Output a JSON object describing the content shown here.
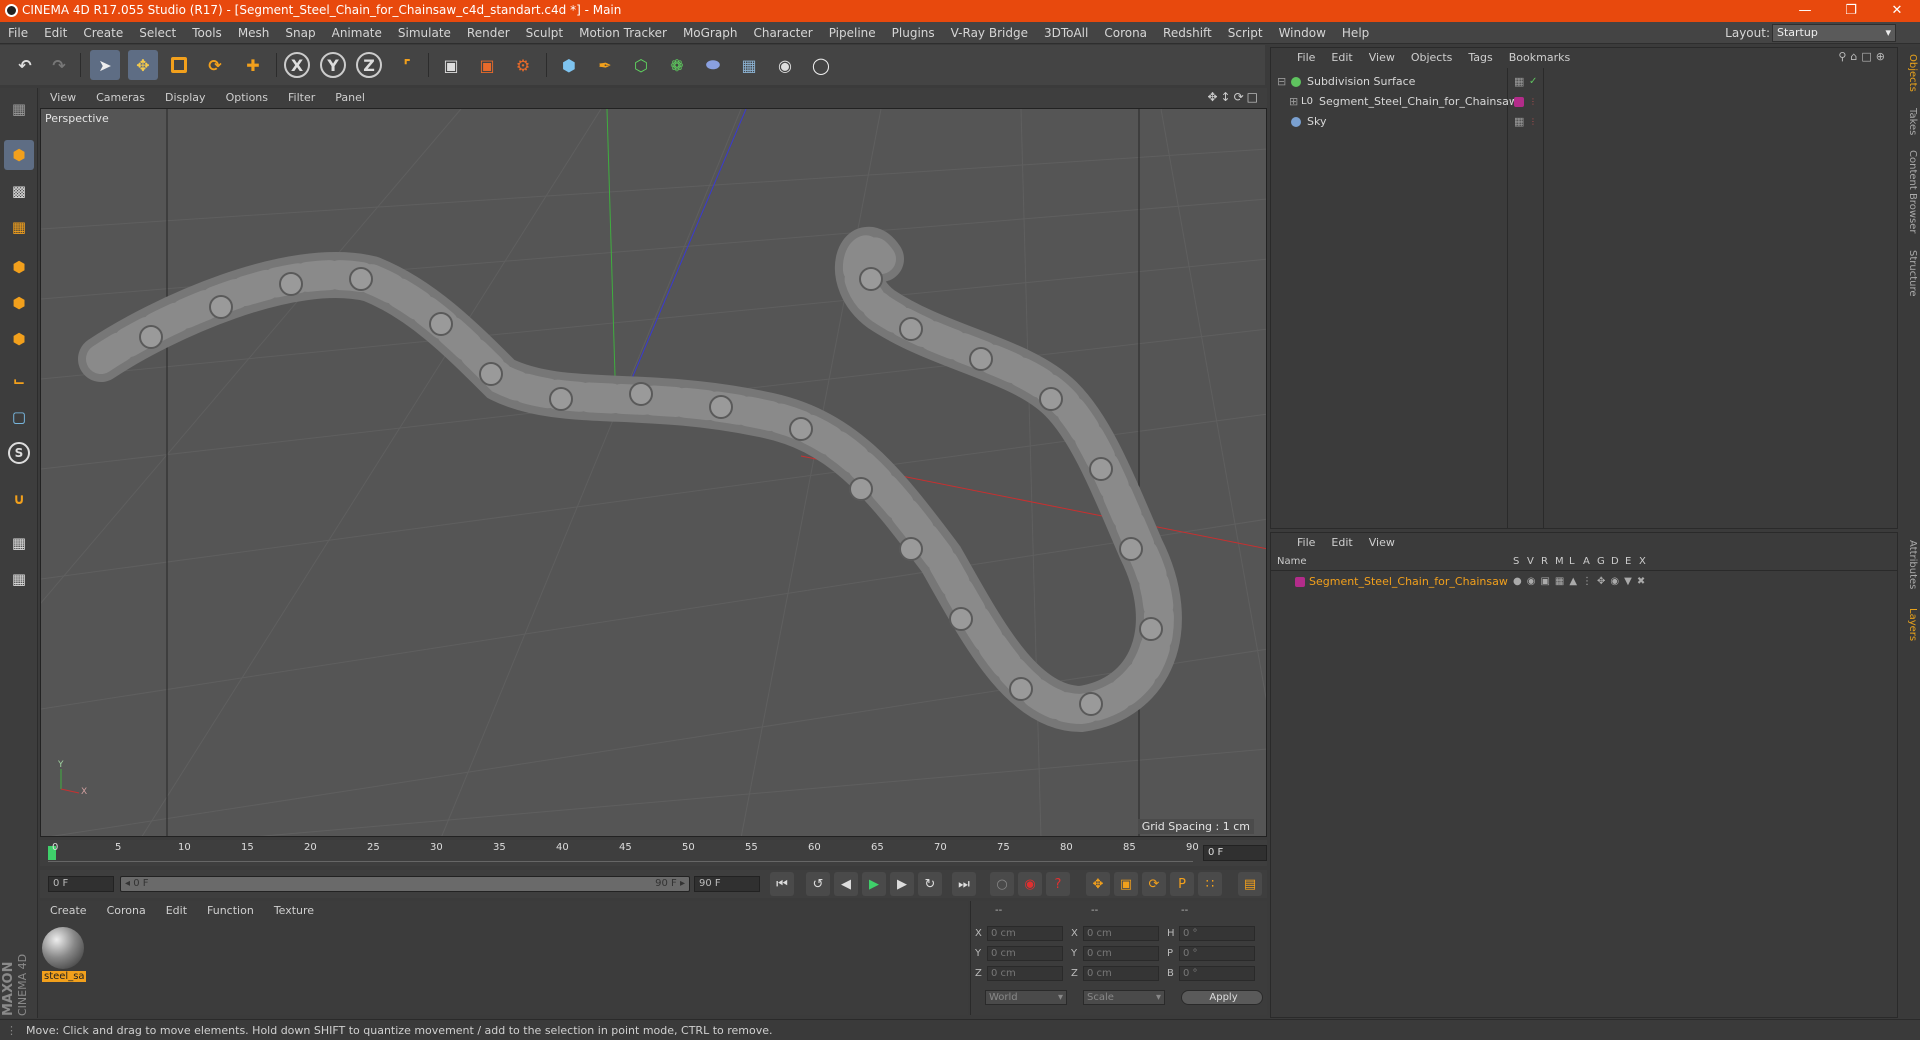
{
  "window": {
    "title": "CINEMA 4D R17.055 Studio (R17) - [Segment_Steel_Chain_for_Chainsaw_c4d_standart.c4d *] - Main",
    "controls": [
      "—",
      "❐",
      "✕"
    ]
  },
  "menubar": {
    "items": [
      "File",
      "Edit",
      "Create",
      "Select",
      "Tools",
      "Mesh",
      "Snap",
      "Animate",
      "Simulate",
      "Render",
      "Sculpt",
      "Motion Tracker",
      "MoGraph",
      "Character",
      "Pipeline",
      "Plugins",
      "V-Ray Bridge",
      "3DToAll",
      "Corona",
      "Redshift",
      "Script",
      "Window",
      "Help"
    ],
    "layout_label": "Layout:",
    "layout_value": "Startup"
  },
  "toolbar": {
    "axis_x": "X",
    "axis_y": "Y",
    "axis_z": "Z"
  },
  "viewport": {
    "menu": [
      "View",
      "Cameras",
      "Display",
      "Options",
      "Filter",
      "Panel"
    ],
    "label": "Perspective",
    "grid_spacing": "Grid Spacing : 1 cm",
    "gizmo_y": "Y",
    "gizmo_x": "X"
  },
  "timeline": {
    "ticks": [
      "0",
      "5",
      "10",
      "15",
      "20",
      "25",
      "30",
      "35",
      "40",
      "45",
      "50",
      "55",
      "60",
      "65",
      "70",
      "75",
      "80",
      "85",
      "90"
    ],
    "frame_field": "0 F",
    "start_field": "0 F",
    "range_start": "◂ 0 F",
    "range_end": "90 F ▸",
    "end_field": "90 F"
  },
  "material_panel": {
    "menu": [
      "Create",
      "Corona",
      "Edit",
      "Function",
      "Texture"
    ],
    "materials": [
      {
        "name": "steel_sa"
      }
    ],
    "brand_1": "MAXON",
    "brand_2": "CINEMA 4D"
  },
  "coords": {
    "headers": [
      "--",
      "--",
      "--"
    ],
    "rows": [
      {
        "a": "X",
        "av": "0 cm",
        "b": "X",
        "bv": "0 cm",
        "c": "H",
        "cv": "0 °"
      },
      {
        "a": "Y",
        "av": "0 cm",
        "b": "Y",
        "bv": "0 cm",
        "c": "P",
        "cv": "0 °"
      },
      {
        "a": "Z",
        "av": "0 cm",
        "b": "Z",
        "bv": "0 cm",
        "c": "B",
        "cv": "0 °"
      }
    ],
    "mode1": "World",
    "mode2": "Scale",
    "apply": "Apply"
  },
  "object_manager": {
    "menu": [
      "File",
      "Edit",
      "View",
      "Objects",
      "Tags",
      "Bookmarks"
    ],
    "objects": [
      {
        "name": "Subdivision Surface",
        "color": "#5fc35f"
      },
      {
        "name": "Segment_Steel_Chain_for_Chainsaw",
        "color": "#b32c8a"
      },
      {
        "name": "Sky",
        "color": "#7aa0d0"
      }
    ]
  },
  "layer_manager": {
    "menu": [
      "File",
      "Edit",
      "View"
    ],
    "col_name": "Name",
    "cols": [
      "S",
      "V",
      "R",
      "M",
      "L",
      "A",
      "G",
      "D",
      "E",
      "X"
    ],
    "layers": [
      {
        "name": "Segment_Steel_Chain_for_Chainsaw",
        "color": "#b32c8a"
      }
    ]
  },
  "right_tabs": [
    "Objects",
    "Takes",
    "Content Browser",
    "Structure",
    "Attributes",
    "Layers"
  ],
  "status": "Move: Click and drag to move elements. Hold down SHIFT to quantize movement / add to the selection in point mode, CTRL to remove."
}
